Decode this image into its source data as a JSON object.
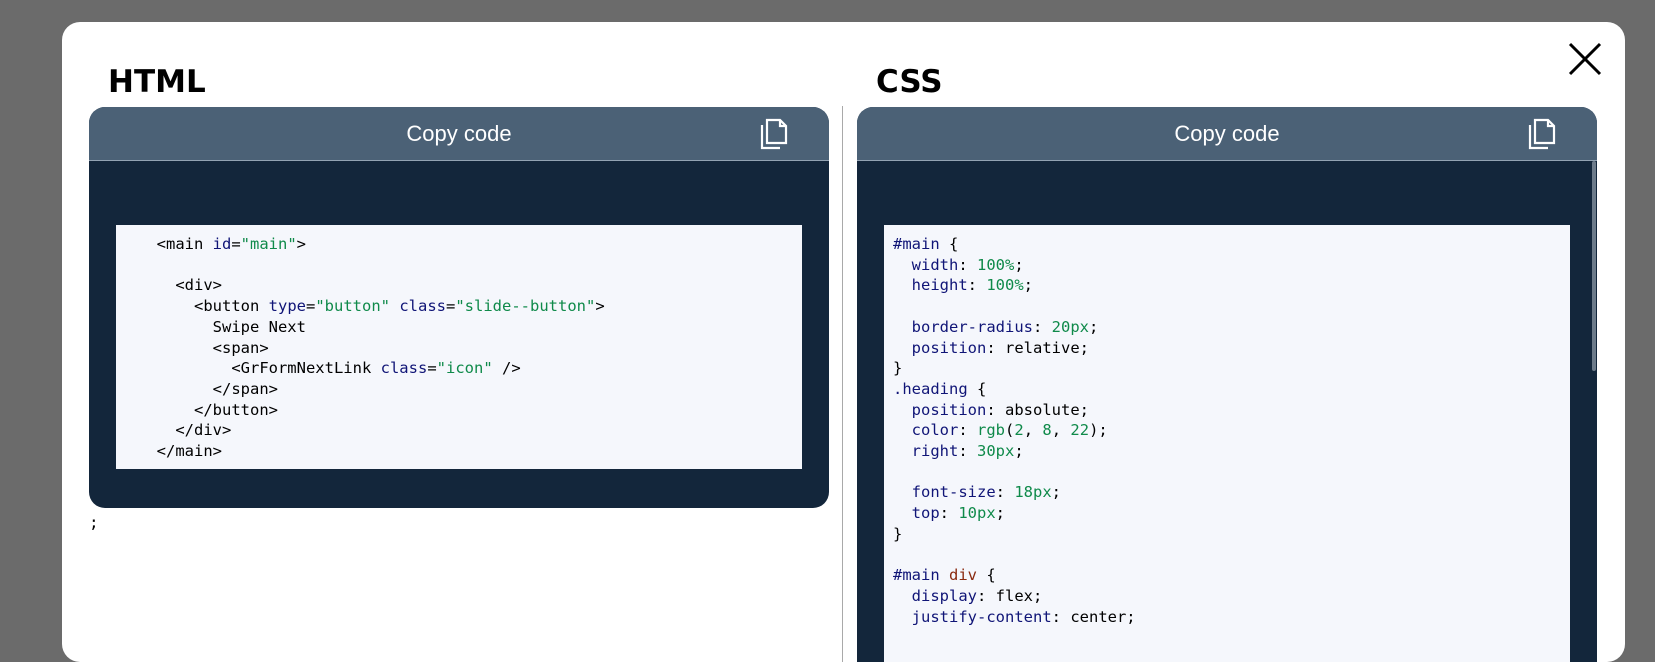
{
  "modal": {
    "close_icon": "close-icon"
  },
  "html_panel": {
    "title": "HTML",
    "copy_label": "Copy code",
    "copy_icon": "copy-icon",
    "trailing_text": ";",
    "code_lines": [
      [
        {
          "t": "tag",
          "v": "  <main "
        },
        {
          "t": "attr",
          "v": "id"
        },
        {
          "t": "tag",
          "v": "="
        },
        {
          "t": "str",
          "v": "\"main\""
        },
        {
          "t": "tag",
          "v": ">"
        }
      ],
      [],
      [
        {
          "t": "tag",
          "v": "    <div>"
        }
      ],
      [
        {
          "t": "tag",
          "v": "      <button "
        },
        {
          "t": "attr",
          "v": "type"
        },
        {
          "t": "tag",
          "v": "="
        },
        {
          "t": "str",
          "v": "\"button\""
        },
        {
          "t": "tag",
          "v": " "
        },
        {
          "t": "attr",
          "v": "class"
        },
        {
          "t": "tag",
          "v": "="
        },
        {
          "t": "str",
          "v": "\"slide--button\""
        },
        {
          "t": "tag",
          "v": ">"
        }
      ],
      [
        {
          "t": "plain",
          "v": "        Swipe Next"
        }
      ],
      [
        {
          "t": "tag",
          "v": "        <span>"
        }
      ],
      [
        {
          "t": "tag",
          "v": "          <GrFormNextLink "
        },
        {
          "t": "attr",
          "v": "class"
        },
        {
          "t": "tag",
          "v": "="
        },
        {
          "t": "str",
          "v": "\"icon\""
        },
        {
          "t": "tag",
          "v": " />"
        }
      ],
      [
        {
          "t": "tag",
          "v": "        </span>"
        }
      ],
      [
        {
          "t": "tag",
          "v": "      </button>"
        }
      ],
      [
        {
          "t": "tag",
          "v": "    </div>"
        }
      ],
      [
        {
          "t": "tag",
          "v": "  </main>"
        }
      ]
    ]
  },
  "css_panel": {
    "title": "CSS",
    "copy_label": "Copy code",
    "copy_icon": "copy-icon",
    "code_lines": [
      [
        {
          "t": "sel",
          "v": "#main"
        },
        {
          "t": "plain",
          "v": " {"
        }
      ],
      [
        {
          "t": "plain",
          "v": "  "
        },
        {
          "t": "prop",
          "v": "width"
        },
        {
          "t": "plain",
          "v": ": "
        },
        {
          "t": "num",
          "v": "100%"
        },
        {
          "t": "plain",
          "v": ";"
        }
      ],
      [
        {
          "t": "plain",
          "v": "  "
        },
        {
          "t": "prop",
          "v": "height"
        },
        {
          "t": "plain",
          "v": ": "
        },
        {
          "t": "num",
          "v": "100%"
        },
        {
          "t": "plain",
          "v": ";"
        }
      ],
      [],
      [
        {
          "t": "plain",
          "v": "  "
        },
        {
          "t": "prop",
          "v": "border-radius"
        },
        {
          "t": "plain",
          "v": ": "
        },
        {
          "t": "num",
          "v": "20px"
        },
        {
          "t": "plain",
          "v": ";"
        }
      ],
      [
        {
          "t": "plain",
          "v": "  "
        },
        {
          "t": "prop",
          "v": "position"
        },
        {
          "t": "plain",
          "v": ": relative;"
        }
      ],
      [
        {
          "t": "plain",
          "v": "}"
        }
      ],
      [
        {
          "t": "sel",
          "v": ".heading"
        },
        {
          "t": "plain",
          "v": " {"
        }
      ],
      [
        {
          "t": "plain",
          "v": "  "
        },
        {
          "t": "prop",
          "v": "position"
        },
        {
          "t": "plain",
          "v": ": absolute;"
        }
      ],
      [
        {
          "t": "plain",
          "v": "  "
        },
        {
          "t": "prop",
          "v": "color"
        },
        {
          "t": "plain",
          "v": ": "
        },
        {
          "t": "fn",
          "v": "rgb"
        },
        {
          "t": "plain",
          "v": "("
        },
        {
          "t": "num",
          "v": "2"
        },
        {
          "t": "plain",
          "v": ", "
        },
        {
          "t": "num",
          "v": "8"
        },
        {
          "t": "plain",
          "v": ", "
        },
        {
          "t": "num",
          "v": "22"
        },
        {
          "t": "plain",
          "v": ");"
        }
      ],
      [
        {
          "t": "plain",
          "v": "  "
        },
        {
          "t": "prop",
          "v": "right"
        },
        {
          "t": "plain",
          "v": ": "
        },
        {
          "t": "num",
          "v": "30px"
        },
        {
          "t": "plain",
          "v": ";"
        }
      ],
      [],
      [
        {
          "t": "plain",
          "v": "  "
        },
        {
          "t": "prop",
          "v": "font-size"
        },
        {
          "t": "plain",
          "v": ": "
        },
        {
          "t": "num",
          "v": "18px"
        },
        {
          "t": "plain",
          "v": ";"
        }
      ],
      [
        {
          "t": "plain",
          "v": "  "
        },
        {
          "t": "prop",
          "v": "top"
        },
        {
          "t": "plain",
          "v": ": "
        },
        {
          "t": "num",
          "v": "10px"
        },
        {
          "t": "plain",
          "v": ";"
        }
      ],
      [
        {
          "t": "plain",
          "v": "}"
        }
      ],
      [],
      [
        {
          "t": "sel",
          "v": "#main"
        },
        {
          "t": "plain",
          "v": " "
        },
        {
          "t": "tagsel",
          "v": "div"
        },
        {
          "t": "plain",
          "v": " {"
        }
      ],
      [
        {
          "t": "plain",
          "v": "  "
        },
        {
          "t": "prop",
          "v": "display"
        },
        {
          "t": "plain",
          "v": ": flex;"
        }
      ],
      [
        {
          "t": "plain",
          "v": "  "
        },
        {
          "t": "prop",
          "v": "justify-content"
        },
        {
          "t": "plain",
          "v": ": center;"
        }
      ]
    ]
  }
}
